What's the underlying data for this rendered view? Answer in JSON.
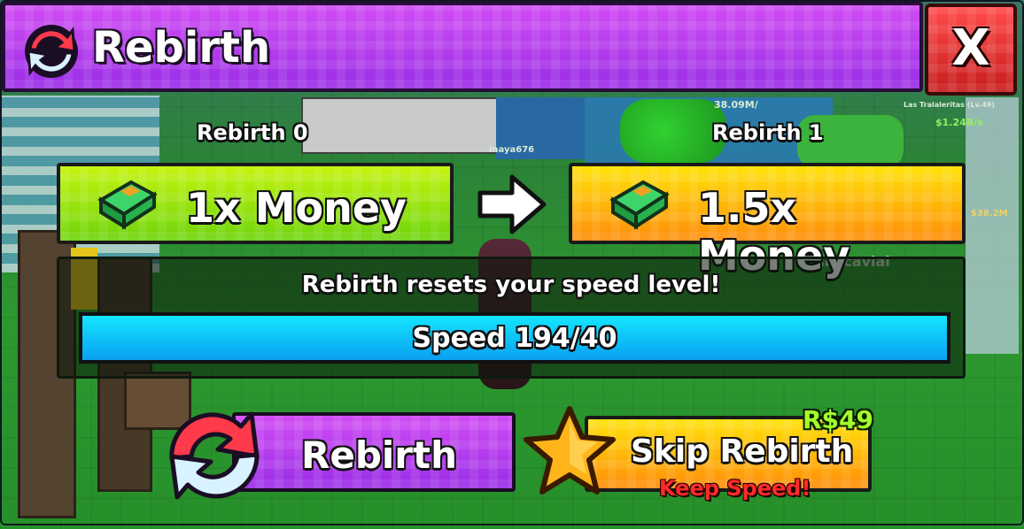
{
  "window": {
    "title": "Rebirth",
    "close_label": "X"
  },
  "rebirth": {
    "current_label": "Rebirth 0",
    "next_label": "Rebirth 1",
    "current_reward": "1x Money",
    "next_reward": "1.5x Money"
  },
  "speed": {
    "message": "Rebirth resets your speed level!",
    "bar_text": "Speed 194/40",
    "current": 194,
    "required": 40,
    "fill_fraction": 1.0
  },
  "actions": {
    "rebirth_label": "Rebirth",
    "skip_label": "Skip Rebirth",
    "skip_sublabel": "Keep Speed!",
    "skip_price": "R$49"
  },
  "background": {
    "player_names": [
      "inaya676",
      "lukacavial"
    ],
    "sign_text": "Las Tralaleritas (Lv.49)",
    "money_rate": "$1.24B/s",
    "money_amount": "38.09M/",
    "cash_tag": "$38.2M"
  },
  "colors": {
    "title_purple": "#c23ff0",
    "close_red": "#e33030",
    "money_green": "#9be40d",
    "money_orange": "#ffb30a",
    "speed_cyan": "#0ec8ff",
    "price_green": "#a2ff2a",
    "keep_red": "#ff2a2a"
  },
  "icons": [
    "rebirth-cycle-icon",
    "cash-stack-icon",
    "right-arrow-icon",
    "star-icon",
    "close-icon"
  ]
}
